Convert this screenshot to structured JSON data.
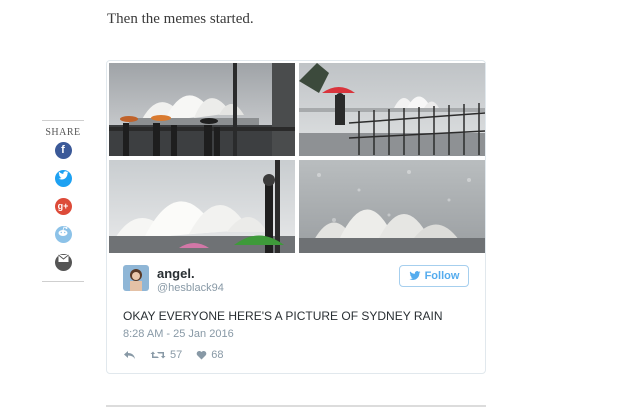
{
  "article": {
    "intro_text": "Then the memes started."
  },
  "share": {
    "label": "SHARE",
    "buttons": [
      {
        "name": "facebook",
        "icon": "facebook-icon",
        "color": "#3b5998",
        "glyph": "f"
      },
      {
        "name": "twitter",
        "icon": "twitter-icon",
        "color": "#1da1f2"
      },
      {
        "name": "google-plus",
        "icon": "google-plus-icon",
        "color": "#dd4b39",
        "glyph": "g+"
      },
      {
        "name": "reddit",
        "icon": "reddit-icon",
        "color": "#8cc2e8"
      },
      {
        "name": "email",
        "icon": "email-icon",
        "color": "#555555"
      }
    ]
  },
  "tweet": {
    "author_name": "angel.",
    "author_handle": "@hesblack94",
    "follow_label": "Follow",
    "text": "OKAY EVERYONE HERE'S A PICTURE OF SYDNEY RAIN",
    "timestamp": "8:28 AM - 25 Jan 2016",
    "retweets": "57",
    "likes": "68",
    "brand_color": "#55acee"
  }
}
